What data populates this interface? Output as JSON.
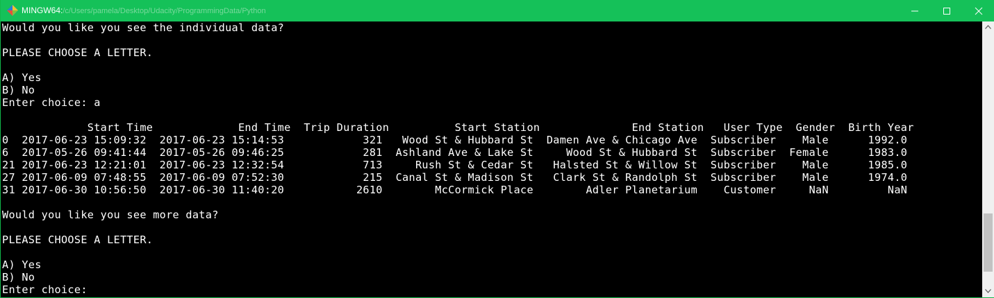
{
  "window": {
    "app_name": "MINGW64:",
    "path": "/c/Users/pamela/Desktop/Udacity/ProgrammingData/Python",
    "icon": "mingw-diamond-icon",
    "controls": [
      "minimize-icon",
      "maximize-icon",
      "close-icon"
    ],
    "colors": {
      "titlebar": "#15c159",
      "terminal_bg": "#000000",
      "terminal_fg": "#ffffff"
    }
  },
  "terminal": {
    "lines": [
      "Would you like you see the individual data?",
      "",
      "PLEASE CHOOSE A LETTER.",
      "",
      "A) Yes",
      "B) No",
      "Enter choice: a",
      "",
      "             Start Time             End Time  Trip Duration          Start Station              End Station   User Type  Gender  Birth Year",
      "0  2017-06-23 15:09:32  2017-06-23 15:14:53            321   Wood St & Hubbard St  Damen Ave & Chicago Ave  Subscriber    Male      1992.0",
      "6  2017-05-26 09:41:44  2017-05-26 09:46:25            281  Ashland Ave & Lake St     Wood St & Hubbard St  Subscriber  Female      1983.0",
      "21 2017-06-23 12:21:01  2017-06-23 12:32:54            713     Rush St & Cedar St   Halsted St & Willow St  Subscriber    Male      1985.0",
      "27 2017-06-09 07:48:55  2017-06-09 07:52:30            215  Canal St & Madison St   Clark St & Randolph St  Subscriber    Male      1974.0",
      "31 2017-06-30 10:56:50  2017-06-30 11:40:20           2610        McCormick Place        Adler Planetarium    Customer     NaN         NaN",
      "",
      "Would you like you see more data?",
      "",
      "PLEASE CHOOSE A LETTER.",
      "",
      "A) Yes",
      "B) No",
      "Enter choice:"
    ]
  }
}
